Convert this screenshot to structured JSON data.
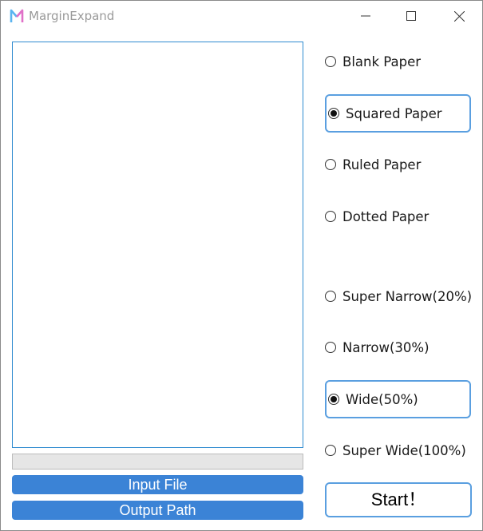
{
  "window": {
    "title": "MarginExpand",
    "icon": "app-logo-icon",
    "controls": [
      "minimize-icon",
      "maximize-icon",
      "close-icon"
    ]
  },
  "progress": {
    "value": 0
  },
  "buttons": {
    "input_file": "Input File",
    "output_path": "Output Path",
    "start": "Start！"
  },
  "paper_types": [
    {
      "label": "Blank Paper",
      "selected": false
    },
    {
      "label": "Squared Paper",
      "selected": true
    },
    {
      "label": "Ruled Paper",
      "selected": false
    },
    {
      "label": "Dotted Paper",
      "selected": false
    }
  ],
  "margin_widths": [
    {
      "label": "Super Narrow(20%)",
      "selected": false
    },
    {
      "label": "Narrow(30%)",
      "selected": false
    },
    {
      "label": "Wide(50%)",
      "selected": true
    },
    {
      "label": "Super Wide(100%)",
      "selected": false
    }
  ],
  "colors": {
    "accent": "#3b83d6",
    "selected_border": "#5a9fe0",
    "preview_border": "#2f8bd0",
    "logo_left": "#5ab4f0",
    "logo_right": "#e070c8"
  }
}
